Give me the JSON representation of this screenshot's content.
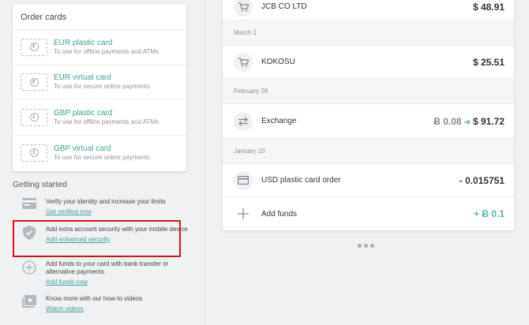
{
  "order_cards": {
    "title": "Order cards",
    "items": [
      {
        "name": "EUR plastic card",
        "desc": "To use for offline payments and ATMs",
        "symbol": "€",
        "icon": "euro-card-icon"
      },
      {
        "name": "EUR virtual card",
        "desc": "To use for secure online payments",
        "symbol": "€",
        "icon": "euro-card-icon"
      },
      {
        "name": "GBP plastic card",
        "desc": "To use for offline payments and ATMs",
        "symbol": "£",
        "icon": "pound-card-icon"
      },
      {
        "name": "GBP virtual card",
        "desc": "To use for secure online payments",
        "symbol": "£",
        "icon": "pound-card-icon"
      }
    ]
  },
  "getting_started": {
    "heading": "Getting started",
    "items": [
      {
        "text": "Verify your identity and increase your limits",
        "link": "Get verified now",
        "icon": "id-card-icon"
      },
      {
        "text": "Add extra account security with your mobile device",
        "link": "Add enhanced security",
        "icon": "shield-icon"
      },
      {
        "text": "Add funds to your card with bank transfer or alternative payments",
        "link": "Add funds now",
        "icon": "plus-circle-icon"
      },
      {
        "text": "Know more with our how-to videos",
        "link": "Watch videos",
        "icon": "play-icon"
      }
    ]
  },
  "transactions": {
    "top": {
      "name": "JCB CO LTD",
      "amount": "$ 48.91",
      "icon": "cart-icon"
    },
    "groups": [
      {
        "date": "March 1",
        "rows": [
          {
            "name": "KOKOSU",
            "amount": "$ 25.51",
            "icon": "cart-icon"
          }
        ]
      },
      {
        "date": "February 28",
        "rows": [
          {
            "name": "Exchange",
            "from": "Ƀ 0.08",
            "to": "$ 91.72",
            "icon": "exchange-icon"
          }
        ]
      },
      {
        "date": "January 10",
        "rows": [
          {
            "name": "USD plastic card order",
            "amount": "- 0.015751",
            "icon": "card-icon"
          },
          {
            "name": "Add funds",
            "amount": "+ Ƀ 0.1",
            "icon": "plus-icon"
          }
        ]
      }
    ]
  },
  "colors": {
    "accent": "#3f9e9a",
    "positive": "#5cb8b2",
    "highlight": "#d0161d"
  }
}
